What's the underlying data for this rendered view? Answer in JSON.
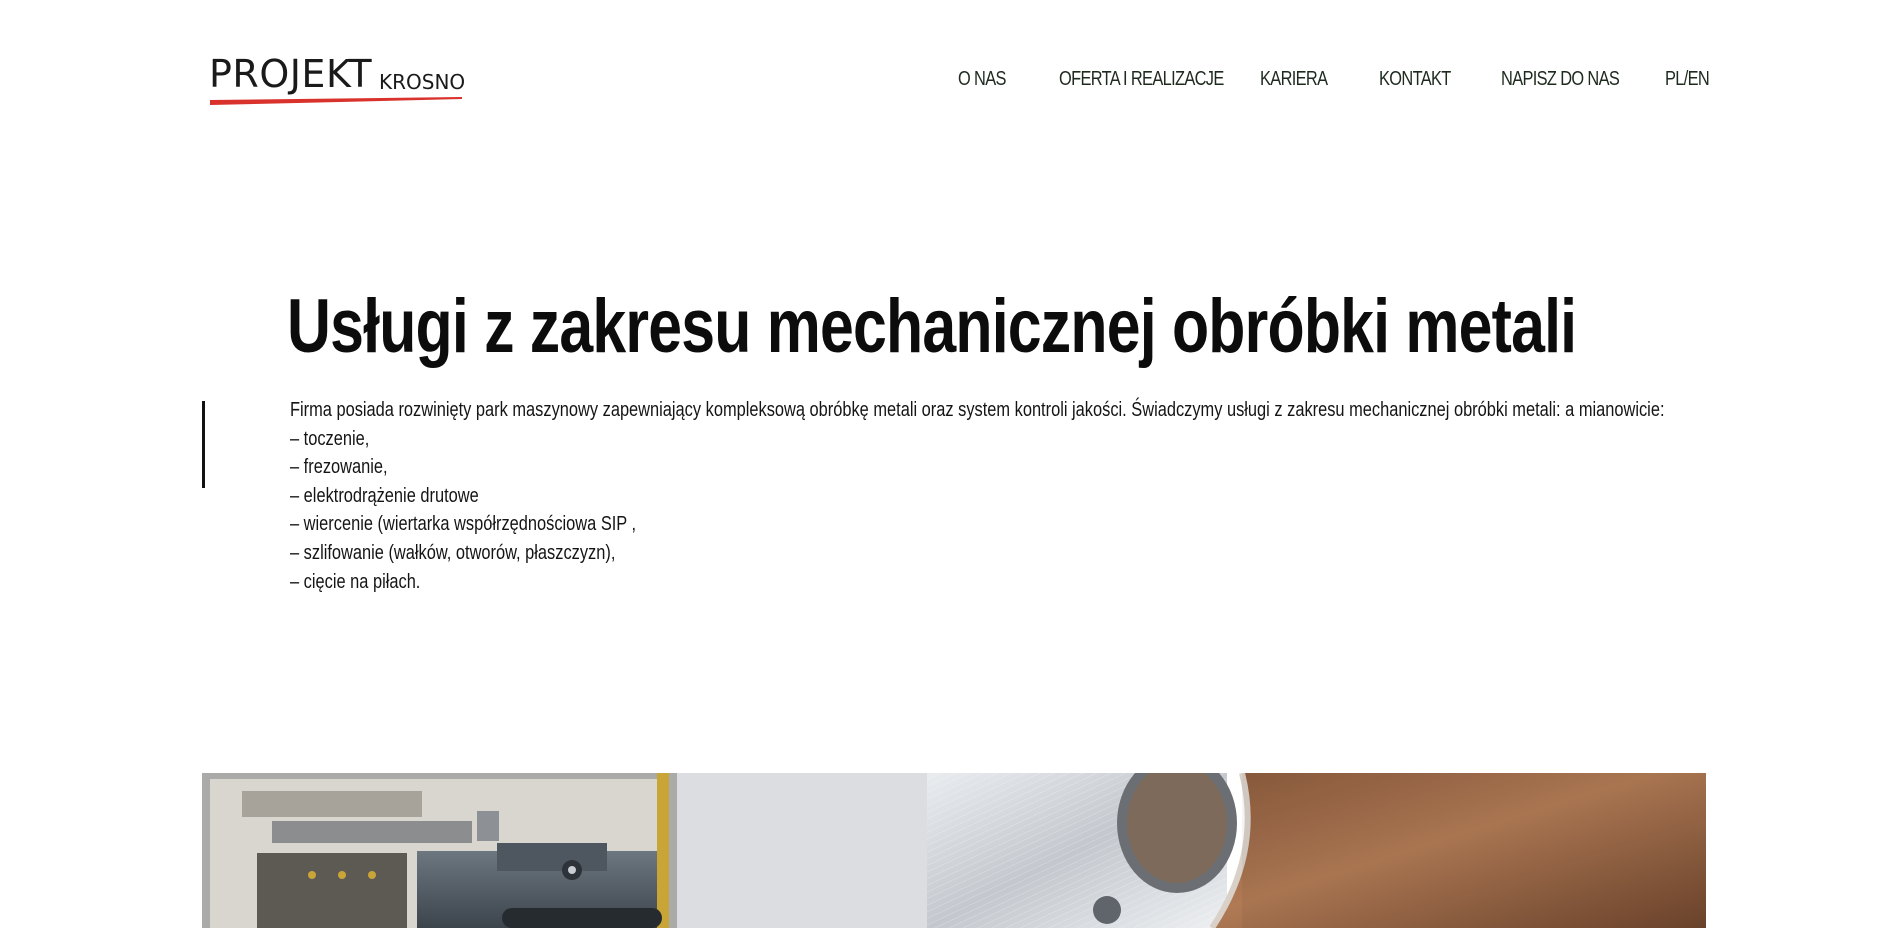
{
  "header": {
    "logo": {
      "main": "PROJEKT",
      "sub": "KROSNO",
      "accent_color": "#d9312b"
    },
    "nav": [
      {
        "label": "O NAS"
      },
      {
        "label": "OFERTA I REALIZACJE"
      },
      {
        "label": "KARIERA"
      },
      {
        "label": "KONTAKT"
      },
      {
        "label": "NAPISZ DO NAS"
      },
      {
        "label": "PL/EN"
      }
    ]
  },
  "main": {
    "title": "Usługi z zakresu mechanicznej obróbki metali",
    "intro": "Firma posiada rozwinięty park maszynowy zapewniający kompleksową obróbkę metali oraz system kontroli jakości. Świadczymy usługi z zakresu mechanicznej obróbki metali: a mianowicie:",
    "services": [
      "– toczenie,",
      "– frezowanie,",
      "– elektrodrążenie drutowe",
      "– wiercenie (wiertarka współrzędnościowa SIP ,",
      "– szlifowanie (wałków, otworów, płaszczyzn),",
      "– cięcie na piłach."
    ]
  },
  "colors": {
    "text": "#111111",
    "nav_text": "#1f2a1f",
    "logo_accent": "#d9312b",
    "background": "#ffffff"
  }
}
